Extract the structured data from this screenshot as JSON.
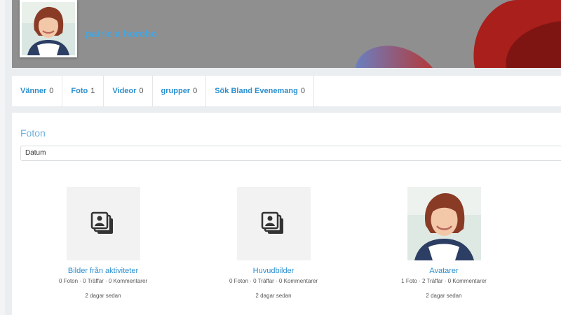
{
  "profile": {
    "name": "patricia horoho",
    "cover_color": "#8f8f8f",
    "accent_red": "#a8201d"
  },
  "tabs": [
    {
      "label": "Vänner",
      "count": "0"
    },
    {
      "label": "Foto",
      "count": "1"
    },
    {
      "label": "Videor",
      "count": "0"
    },
    {
      "label": "grupper",
      "count": "0"
    },
    {
      "label": "Sök Bland Evenemang",
      "count": "0"
    }
  ],
  "photos": {
    "title": "Foton",
    "sort_value": "Datum",
    "albums": [
      {
        "title": "Bilder från aktiviteter",
        "stats": "0 Foton · 0 Träffar · 0 Kommentarer",
        "time": "2 dagar sedan",
        "thumb": "photo-stack-icon"
      },
      {
        "title": "Huvudbilder",
        "stats": "0 Foton · 0 Träffar · 0 Kommentarer",
        "time": "2 dagar sedan",
        "thumb": "photo-stack-icon"
      },
      {
        "title": "Avatarer",
        "stats": "1 Foto · 2 Träffar · 0 Kommentarer",
        "time": "2 dagar sedan",
        "thumb": "portrait-photo"
      }
    ]
  }
}
